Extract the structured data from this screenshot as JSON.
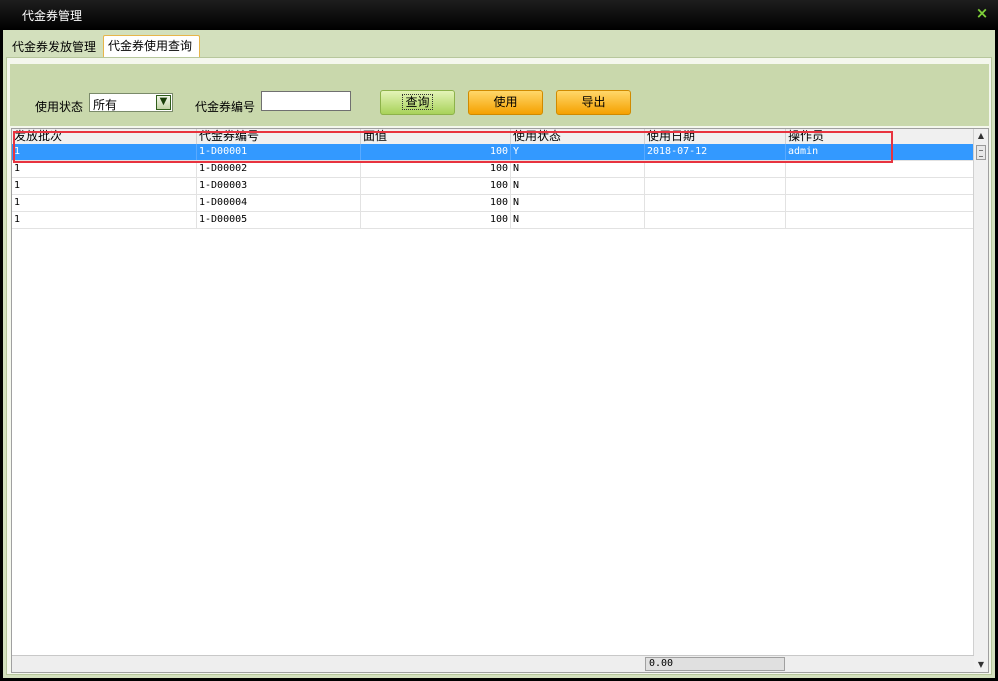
{
  "window": {
    "title": "代金券管理",
    "close_glyph": "×"
  },
  "tabs": [
    {
      "label": "代金券发放管理",
      "active": false
    },
    {
      "label": "代金券使用查询",
      "active": true
    }
  ],
  "filter": {
    "status_label": "使用状态",
    "status_value": "所有",
    "code_label": "代金券编号",
    "code_value": "",
    "query_label": "查询",
    "use_label": "使用",
    "export_label": "导出"
  },
  "grid": {
    "columns": [
      "发放批次",
      "代金券编号",
      "面值",
      "使用状态",
      "使用日期",
      "操作员"
    ],
    "rows": [
      {
        "batch": "1",
        "code": "1-D00001",
        "value": "100",
        "status": "Y",
        "date": "2018-07-12",
        "operator": "admin",
        "selected": true
      },
      {
        "batch": "1",
        "code": "1-D00002",
        "value": "100",
        "status": "N",
        "date": "",
        "operator": "",
        "selected": false
      },
      {
        "batch": "1",
        "code": "1-D00003",
        "value": "100",
        "status": "N",
        "date": "",
        "operator": "",
        "selected": false
      },
      {
        "batch": "1",
        "code": "1-D00004",
        "value": "100",
        "status": "N",
        "date": "",
        "operator": "",
        "selected": false
      },
      {
        "batch": "1",
        "code": "1-D00005",
        "value": "100",
        "status": "N",
        "date": "",
        "operator": "",
        "selected": false
      }
    ],
    "footer_total": "0.00"
  },
  "colors": {
    "accent_selected_row": "#3399ff",
    "highlight_box": "#e8333f",
    "client_bg": "#d3e0bd"
  },
  "icons": {
    "close": "close-icon",
    "dropdown": "chevron-down-icon",
    "scroll_up": "scroll-up-icon",
    "scroll_down": "scroll-down-icon"
  }
}
